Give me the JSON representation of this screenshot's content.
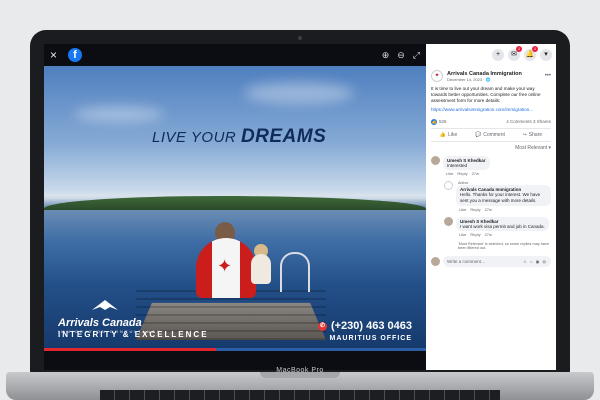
{
  "device": {
    "label": "MacBook Pro"
  },
  "viewer": {
    "close": "×",
    "fb_logo": "f",
    "tools": [
      "⊕",
      "⊖",
      "⤢"
    ],
    "progress": 0.45
  },
  "ad": {
    "headline_prefix": "LIVE YOUR",
    "headline_emphasis": "DREAMS",
    "brand_name": "Arrivals Canada",
    "brand_sub": "IMMIGRATION CONSULTANCY",
    "tagline": "INTEGRITY & EXCELLENCE",
    "phone": "(+230) 463 0463",
    "office": "MAURITIUS OFFICE"
  },
  "panel": {
    "top_buttons": [
      {
        "icon": "+",
        "badge": ""
      },
      {
        "icon": "✉",
        "badge": "1"
      },
      {
        "icon": "🔔",
        "badge": "1"
      },
      {
        "icon": "▾",
        "badge": ""
      }
    ],
    "page_name": "Arrivals Canada Immigration",
    "post_date": "December 14, 2023 · 🌐",
    "post_text": "It is time to live out your dream and make your way towards better opportunities. Complete our free online assessment form for more details:",
    "post_link": "https://www.arrivalsimmigration.com/immigration...",
    "reactions": "526",
    "comments_shares": "4 Comments 3 Shares",
    "actions": {
      "like": "Like",
      "comment": "Comment",
      "share": "Share"
    },
    "sort": "Most Relevant ▾",
    "comments": [
      {
        "name": "Umesh S Khedkar",
        "text": "Interested",
        "meta": [
          "Like",
          "Reply",
          "27w"
        ]
      },
      {
        "author_tag": "Author",
        "name": "Arrivals Canada Immigration",
        "text": "Hello. Thanks for your interest. We have sent you a message with more details.",
        "meta": [
          "Like",
          "Reply",
          "27w"
        ]
      },
      {
        "name": "Umesh S Khedkar",
        "text": "I want work visa permit and job in Canada.",
        "meta": [
          "Like",
          "Reply",
          "27w"
        ]
      }
    ],
    "note": "'Most Relevant' is selected, so some replies may have been filtered out.",
    "write_placeholder": "Write a comment…",
    "write_icons": "☺ ⌂ ▣ ◍"
  }
}
